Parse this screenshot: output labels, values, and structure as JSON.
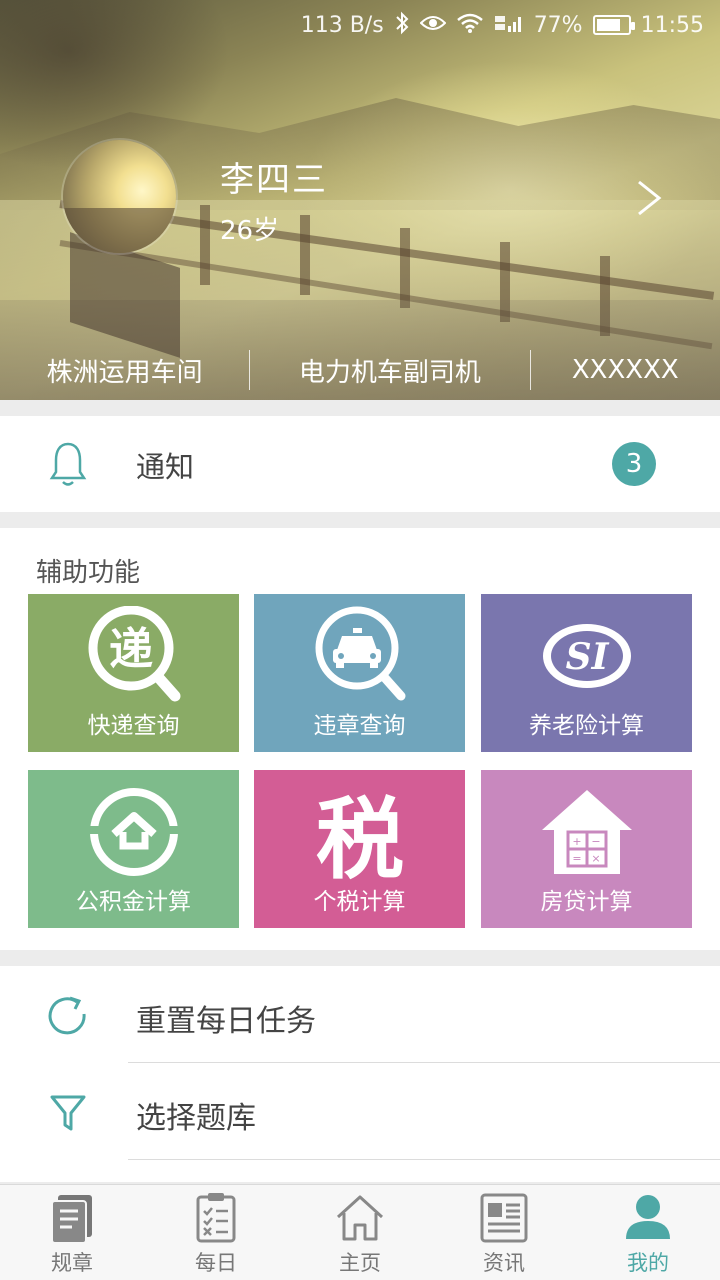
{
  "status_bar": {
    "network_speed": "113 B/s",
    "battery_percent": "77%",
    "battery_level": 0.77,
    "time": "11:55",
    "icons": [
      "bluetooth-icon",
      "eye-icon",
      "wifi-icon",
      "signal-icon",
      "battery-icon"
    ]
  },
  "profile": {
    "name": "李四三",
    "age": "26岁",
    "workshop": "株洲运用车间",
    "position": "电力机车副司机",
    "extra": "XXXXXX"
  },
  "notification": {
    "label": "通知",
    "count": "3"
  },
  "aux": {
    "title": "辅助功能",
    "tiles": [
      {
        "label": "快递查询",
        "color": "#8aab66",
        "icon": "express-search-icon",
        "glyph": "递"
      },
      {
        "label": "违章查询",
        "color": "#70a5bc",
        "icon": "violation-search-icon"
      },
      {
        "label": "养老险计算",
        "color": "#7a76ae",
        "icon": "social-insurance-icon",
        "glyph": "SI"
      },
      {
        "label": "公积金计算",
        "color": "#7ebb8b",
        "icon": "housing-fund-icon"
      },
      {
        "label": "个税计算",
        "color": "#d35d95",
        "icon": "tax-icon",
        "glyph": "税"
      },
      {
        "label": "房贷计算",
        "color": "#c888be",
        "icon": "mortgage-calculator-icon"
      }
    ]
  },
  "menu": {
    "items": [
      {
        "label": "重置每日任务",
        "icon": "refresh-icon"
      },
      {
        "label": "选择题库",
        "icon": "filter-icon"
      }
    ]
  },
  "bottom_nav": {
    "items": [
      {
        "label": "规章",
        "icon": "regulations-icon",
        "active": false
      },
      {
        "label": "每日",
        "icon": "daily-checklist-icon",
        "active": false
      },
      {
        "label": "主页",
        "icon": "home-icon",
        "active": false
      },
      {
        "label": "资讯",
        "icon": "news-icon",
        "active": false
      },
      {
        "label": "我的",
        "icon": "profile-icon",
        "active": true
      }
    ]
  },
  "colors": {
    "accent": "#4ea8a6",
    "nav_inactive": "#777777"
  }
}
